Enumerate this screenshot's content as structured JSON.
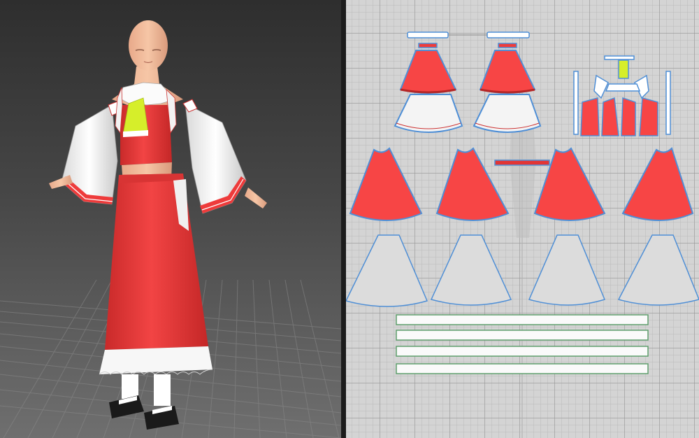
{
  "scene": {
    "view_3d": "avatar-with-garment",
    "view_2d": "pattern-layout"
  },
  "colors": {
    "garment_red": "#ee3b3b",
    "pattern_red": "#f74545",
    "lining_white": "#f4f4f4",
    "skin": "#efb894",
    "collar_yellow": "#d6ee2a",
    "pattern_outline": "#4f8fd6",
    "pattern_outline_green": "#5e9e6c",
    "grid_bg": "#d4d4d4"
  },
  "pattern_pieces": {
    "sleeve_cuffs": 2,
    "sleeve_pieces": 2,
    "sleeve_linings": 2,
    "skirt_front_back_panels": 4,
    "skirt_hem_ruffles": 4,
    "waistband_strips": 4,
    "top_and_collar_group": 1
  }
}
